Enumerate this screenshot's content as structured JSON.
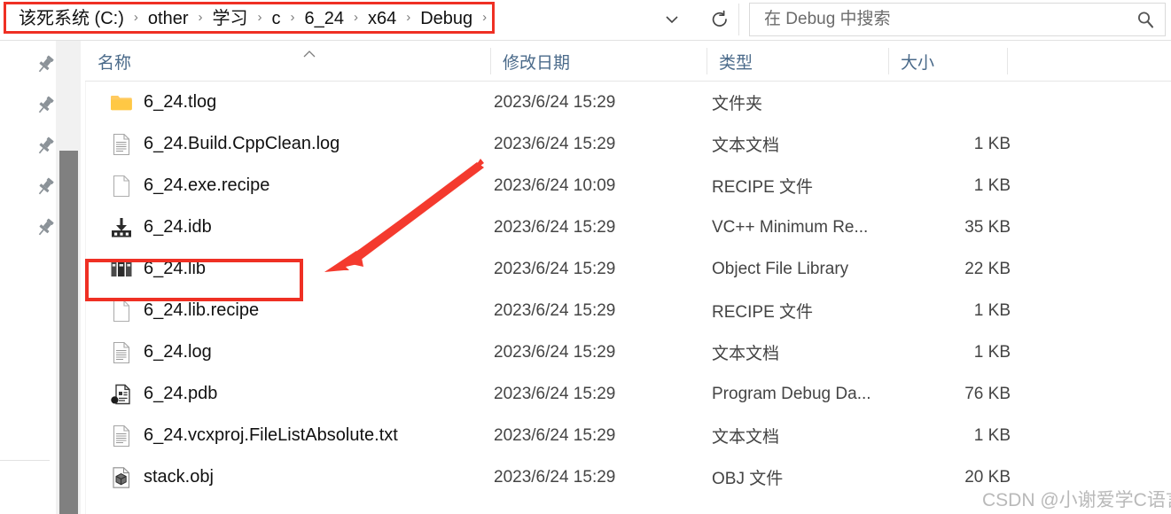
{
  "window": {
    "type": "file-explorer",
    "accent_red": "#ef3024",
    "header_text_color": "#4a6a8a"
  },
  "address_bar": {
    "breadcrumbs": [
      "该死系统 (C:)",
      "other",
      "学习",
      "c",
      "6_24",
      "x64",
      "Debug"
    ],
    "separator": "›",
    "chevron_icon": "chevron-down-icon",
    "refresh_icon": "refresh-icon",
    "highlighted": true
  },
  "search": {
    "placeholder": "在 Debug 中搜索",
    "value": "",
    "icon": "search-icon"
  },
  "sidebar": {
    "pin_icon": "pin-icon",
    "pin_count": 5,
    "scrollbar": {
      "orientation": "vertical",
      "thumb_color": "#808080",
      "track_color": "#f1f1f1"
    }
  },
  "columns": [
    {
      "label": "名称",
      "key": "name",
      "sorted": true,
      "sort_direction": "ascending"
    },
    {
      "label": "修改日期",
      "key": "date",
      "sorted": false,
      "sort_direction": ""
    },
    {
      "label": "类型",
      "key": "type",
      "sorted": false,
      "sort_direction": ""
    },
    {
      "label": "大小",
      "key": "size",
      "sorted": false,
      "sort_direction": ""
    }
  ],
  "files": [
    {
      "name": "6_24.tlog",
      "icon": "folder-icon",
      "date": "2023/6/24 15:29",
      "type": "文件夹",
      "size": "",
      "highlighted": false
    },
    {
      "name": "6_24.Build.CppClean.log",
      "icon": "text-file-icon",
      "date": "2023/6/24 15:29",
      "type": "文本文档",
      "size": "1 KB",
      "highlighted": false
    },
    {
      "name": "6_24.exe.recipe",
      "icon": "blank-file-icon",
      "date": "2023/6/24 10:09",
      "type": "RECIPE 文件",
      "size": "1 KB",
      "highlighted": false
    },
    {
      "name": "6_24.idb",
      "icon": "idb-file-icon",
      "date": "2023/6/24 15:29",
      "type": "VC++ Minimum Re...",
      "size": "35 KB",
      "highlighted": false
    },
    {
      "name": "6_24.lib",
      "icon": "library-icon",
      "date": "2023/6/24 15:29",
      "type": "Object File Library",
      "size": "22 KB",
      "highlighted": true
    },
    {
      "name": "6_24.lib.recipe",
      "icon": "blank-file-icon",
      "date": "2023/6/24 15:29",
      "type": "RECIPE 文件",
      "size": "1 KB",
      "highlighted": false
    },
    {
      "name": "6_24.log",
      "icon": "text-file-icon",
      "date": "2023/6/24 15:29",
      "type": "文本文档",
      "size": "1 KB",
      "highlighted": false
    },
    {
      "name": "6_24.pdb",
      "icon": "pdb-file-icon",
      "date": "2023/6/24 15:29",
      "type": "Program Debug Da...",
      "size": "76 KB",
      "highlighted": false
    },
    {
      "name": "6_24.vcxproj.FileListAbsolute.txt",
      "icon": "text-file-icon",
      "date": "2023/6/24 15:29",
      "type": "文本文档",
      "size": "1 KB",
      "highlighted": false
    },
    {
      "name": "stack.obj",
      "icon": "obj-file-icon",
      "date": "2023/6/24 15:29",
      "type": "OBJ 文件",
      "size": "20 KB",
      "highlighted": false
    }
  ],
  "annotations": {
    "arrow": {
      "icon": "red-arrow-icon",
      "color": "#ef3024",
      "points_to": "6_24.lib"
    },
    "box": {
      "color": "#ef3024",
      "around": "6_24.lib"
    }
  },
  "watermark": {
    "text": "CSDN @小谢爱学C语言"
  }
}
